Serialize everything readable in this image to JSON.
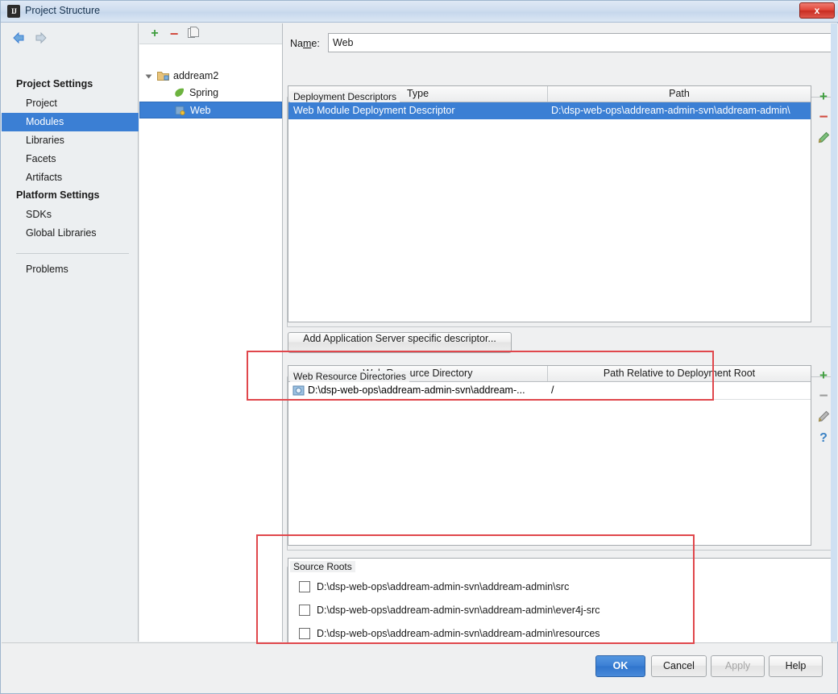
{
  "window": {
    "title": "Project Structure",
    "icon": "intellij-idea-icon",
    "close_label": "x"
  },
  "sidebar": {
    "nav": {
      "back": "back-arrow",
      "forward": "forward-arrow"
    },
    "groups": [
      {
        "label": "Project Settings"
      },
      {
        "label": "Platform Settings"
      }
    ],
    "items": [
      {
        "label": "Project",
        "selected": false
      },
      {
        "label": "Modules",
        "selected": true
      },
      {
        "label": "Libraries",
        "selected": false
      },
      {
        "label": "Facets",
        "selected": false
      },
      {
        "label": "Artifacts",
        "selected": false
      },
      {
        "label": "SDKs",
        "selected": false
      },
      {
        "label": "Global Libraries",
        "selected": false
      },
      {
        "label": "Problems",
        "selected": false
      }
    ]
  },
  "tree": {
    "toolbar": {
      "add": "plus-icon",
      "remove": "minus-icon",
      "copy": "copy-icon"
    },
    "nodes": [
      {
        "label": "addream2",
        "icon": "module-folder-icon",
        "selected": false
      },
      {
        "label": "Spring",
        "icon": "spring-leaf-icon",
        "selected": false
      },
      {
        "label": "Web",
        "icon": "web-facet-icon",
        "selected": true
      }
    ]
  },
  "main": {
    "name_label": "Name:",
    "name_value": "Web",
    "deployment": {
      "title": "Deployment Descriptors",
      "columns": [
        "Type",
        "Path"
      ],
      "rows": [
        {
          "type": "Web Module Deployment Descriptor",
          "path": "D:\\dsp-web-ops\\addream-admin-svn\\addream-admin\\",
          "selected": true
        }
      ],
      "tools": [
        "plus-icon",
        "minus-icon",
        "pencil-icon"
      ],
      "add_button": "Add Application Server specific descriptor..."
    },
    "web_resources": {
      "title": "Web Resource Directories",
      "columns": [
        "Web Resource Directory",
        "Path Relative to Deployment Root"
      ],
      "rows": [
        {
          "directory": "D:\\dsp-web-ops\\addream-admin-svn\\addream-...",
          "relative": "/",
          "icon": "folder-web-icon"
        }
      ],
      "tools": [
        "plus-icon",
        "minus-icon",
        "pencil-icon",
        "help-icon"
      ]
    },
    "source_roots": {
      "title": "Source Roots",
      "rows": [
        {
          "path": "D:\\dsp-web-ops\\addream-admin-svn\\addream-admin\\src",
          "checked": false
        },
        {
          "path": "D:\\dsp-web-ops\\addream-admin-svn\\addream-admin\\ever4j-src",
          "checked": false
        },
        {
          "path": "D:\\dsp-web-ops\\addream-admin-svn\\addream-admin\\resources",
          "checked": false
        }
      ]
    }
  },
  "footer": {
    "ok": "OK",
    "cancel": "Cancel",
    "apply": "Apply",
    "help": "Help"
  },
  "colors": {
    "selection_blue": "#3b7fd4",
    "annotation_red": "#e0474c",
    "window_bg": "#eff0f1"
  }
}
